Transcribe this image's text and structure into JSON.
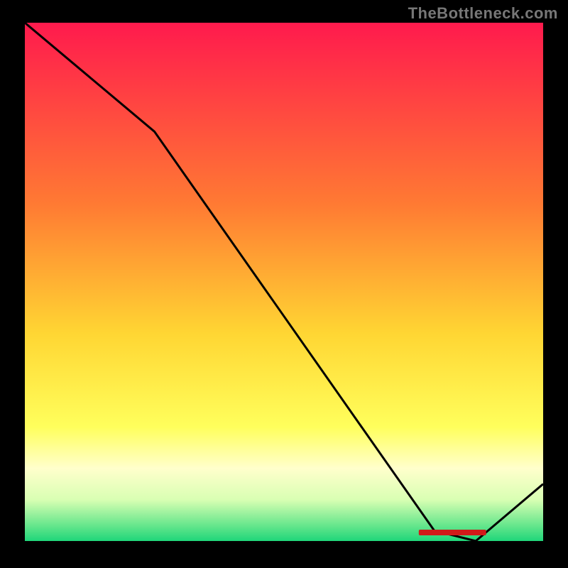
{
  "watermark": "TheBottleneck.com",
  "chart_data": {
    "type": "line",
    "title": "",
    "xlabel": "",
    "ylabel": "",
    "xlim": [
      0,
      100
    ],
    "ylim": [
      0,
      100
    ],
    "x": [
      0,
      25,
      79,
      87,
      100
    ],
    "values": [
      100,
      79,
      2,
      0,
      11
    ],
    "annotation_label": "",
    "annotation_x_range": [
      76,
      89
    ],
    "gradient_stops": [
      {
        "offset": 0.0,
        "color": "#ff1a4d"
      },
      {
        "offset": 0.35,
        "color": "#ff7a33"
      },
      {
        "offset": 0.6,
        "color": "#ffd633"
      },
      {
        "offset": 0.78,
        "color": "#ffff5c"
      },
      {
        "offset": 0.86,
        "color": "#ffffcc"
      },
      {
        "offset": 0.92,
        "color": "#d9ffb3"
      },
      {
        "offset": 0.97,
        "color": "#66e68c"
      },
      {
        "offset": 1.0,
        "color": "#1fd67a"
      }
    ]
  }
}
